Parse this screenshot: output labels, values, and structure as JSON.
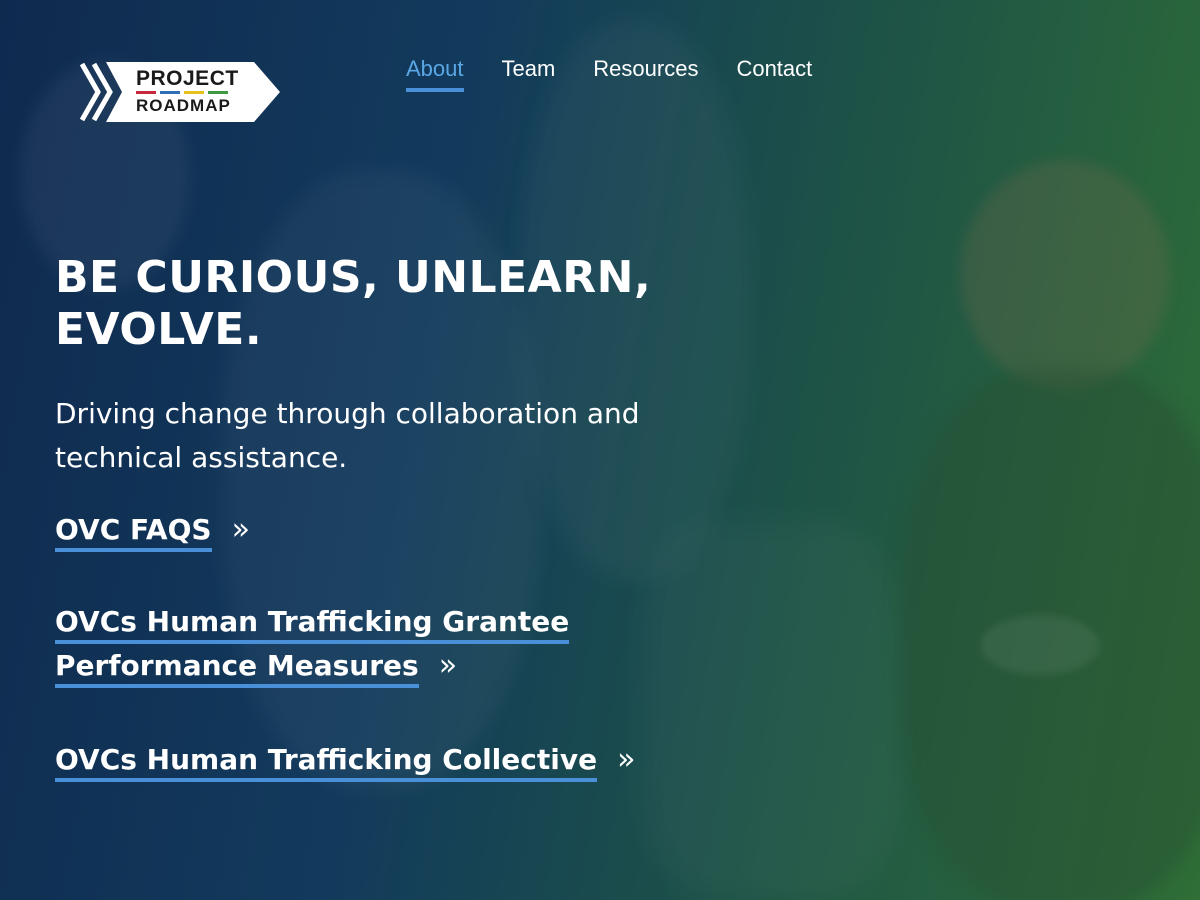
{
  "colors": {
    "accent": "#4a90d9",
    "nav_active": "#5aa7e6",
    "logo_bars": [
      "#c8283c",
      "#2f6fb8",
      "#e8c21c",
      "#3e9a42"
    ]
  },
  "logo": {
    "line1": "PROJECT",
    "line2": "ROADMAP"
  },
  "nav": {
    "items": [
      {
        "label": "About",
        "active": true
      },
      {
        "label": "Team",
        "active": false
      },
      {
        "label": "Resources",
        "active": false
      },
      {
        "label": "Contact",
        "active": false
      }
    ]
  },
  "hero": {
    "headline": "BE CURIOUS, UNLEARN, EVOLVE.",
    "subtext": "Driving change through collaboration and technical assistance.",
    "links": [
      {
        "label": "OVC FAQS",
        "icon": "double-chevron-right-icon",
        "glyph": "»"
      },
      {
        "label": "OVCs Human Trafficking Grantee Performance Measures",
        "icon": "double-chevron-right-icon",
        "glyph": "»"
      },
      {
        "label": "OVCs Human Trafficking Collective",
        "icon": "double-chevron-right-icon",
        "glyph": "»"
      }
    ]
  }
}
